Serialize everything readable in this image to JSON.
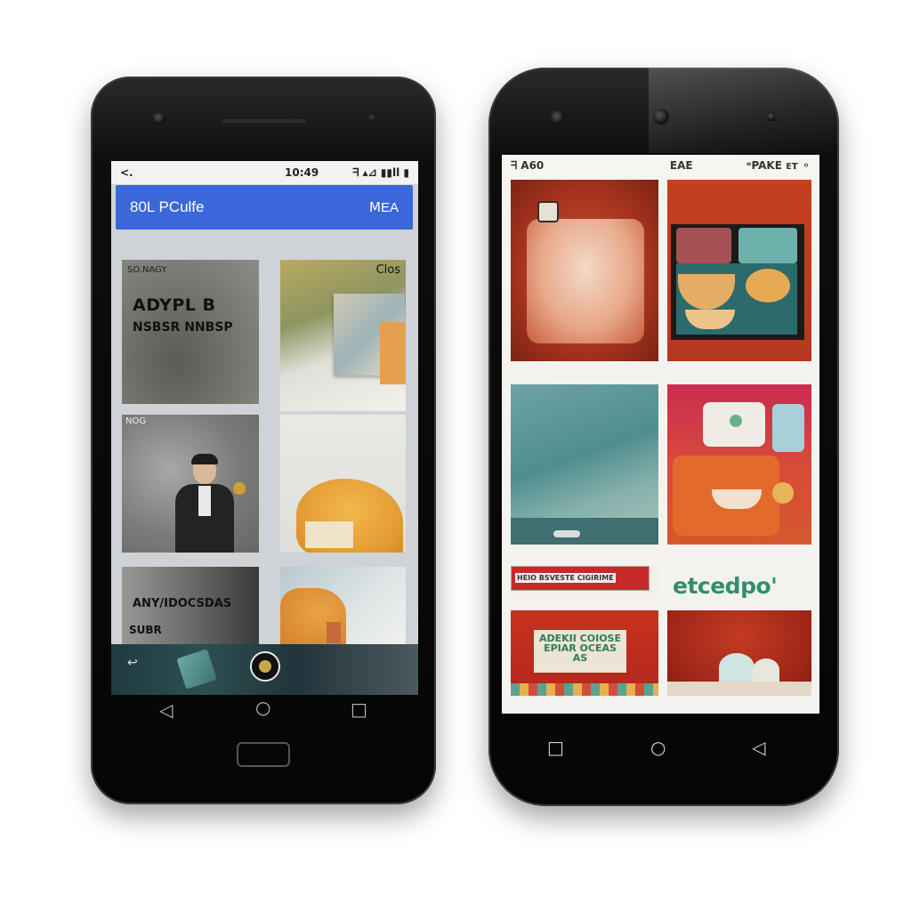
{
  "left_phone": {
    "status_bar": {
      "left": "<.",
      "time": "10:49",
      "right": "ᖷ ▴⊿ ▮▮ll ▮"
    },
    "app_bar": {
      "title": "80L PCulfe",
      "action": "ⅯEA"
    },
    "cards": [
      {
        "caption_small": "SO.NAGY",
        "caption_title": "ADYPL B",
        "caption_sub": "NSBSR NNBSP"
      },
      {
        "caption_small": "Clos"
      },
      {
        "caption_small": "NOG"
      },
      {
        "caption_small": ""
      },
      {
        "caption_title": "ANY/IDOCSDAS",
        "caption_sub": "SUBR"
      },
      {
        "caption_small": ""
      }
    ],
    "nav": {
      "back": "◁",
      "home": "○",
      "recents": "□"
    }
  },
  "right_phone": {
    "status_bar": {
      "left": "ᖷ  A60",
      "center": "EAE",
      "right": "ᵒPAKE ᴇᴛ ⚬"
    },
    "tiles": [
      {
        "label": ""
      },
      {
        "label": ""
      },
      {
        "label": ""
      },
      {
        "label": ""
      },
      {
        "label": "HEIO BSVESTE CIGIRIME"
      },
      {
        "label": "etcedpo'"
      },
      {
        "label": "ADEKII COIOSE EPIAR OCEAS AS"
      },
      {
        "label": ""
      }
    ],
    "nav": {
      "recents": "□",
      "home": "○",
      "back": "◁"
    }
  },
  "colors": {
    "app_bar_blue": "#3a67da",
    "status_bg": "#f2f2f2",
    "accent_red": "#c23a26",
    "teal": "#2f7b7c"
  }
}
